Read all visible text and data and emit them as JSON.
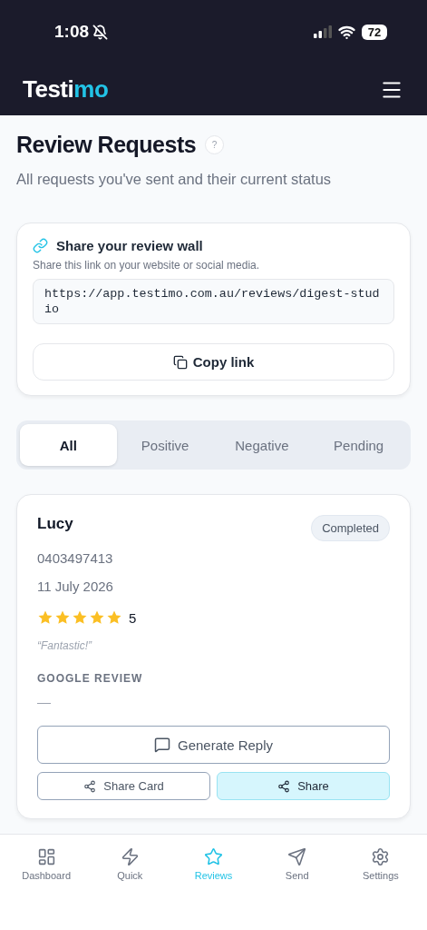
{
  "status_bar": {
    "time": "1:08",
    "battery": "72"
  },
  "header": {
    "logo": {
      "text": "Testi",
      "accent": "mo"
    }
  },
  "page": {
    "title": "Review Requests",
    "help": "?",
    "subtitle": "All requests you've sent and their current status"
  },
  "share_wall": {
    "title": "Share your review wall",
    "description": "Share this link on your website or social media.",
    "link": "https://app.testimo.com.au/reviews/digest-studio",
    "button": "Copy link"
  },
  "tabs": [
    {
      "label": "All",
      "selected": true
    },
    {
      "label": "Positive",
      "selected": false
    },
    {
      "label": "Negative",
      "selected": false
    },
    {
      "label": "Pending",
      "selected": false
    }
  ],
  "requests": [
    {
      "name": "Lucy",
      "status": "Completed",
      "phone": "0403497413",
      "date": "11 July 2026",
      "stars": 5,
      "rating": "5",
      "quote": "“Fantastic!”",
      "google_label": "GOOGLE REVIEW",
      "google_value": "—",
      "buttons": {
        "reply": "Generate Reply",
        "share_card": "Share Card",
        "share": "Share"
      }
    }
  ],
  "nav": [
    {
      "label": "Dashboard",
      "selected": false
    },
    {
      "label": "Quick",
      "selected": false
    },
    {
      "label": "Reviews",
      "selected": true
    },
    {
      "label": "Send",
      "selected": false
    },
    {
      "label": "Settings",
      "selected": false
    }
  ]
}
